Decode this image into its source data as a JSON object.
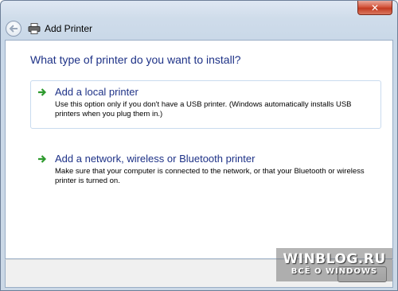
{
  "window": {
    "close_glyph": "✕"
  },
  "header": {
    "title": "Add Printer",
    "back_icon": "back-arrow-icon",
    "app_icon": "printer-icon"
  },
  "question": "What type of printer do you want to install?",
  "options": [
    {
      "title": "Add a local printer",
      "description": "Use this option only if you don't have a USB printer. (Windows automatically installs USB printers when you plug them in.)",
      "icon": "green-arrow-icon"
    },
    {
      "title": "Add a network, wireless or Bluetooth printer",
      "description": "Make sure that your computer is connected to the network, or that your Bluetooth or wireless printer is turned on.",
      "icon": "green-arrow-icon"
    }
  ],
  "watermark": {
    "title": "WINBLOG.RU",
    "subtitle": "ВСЁ О WINDOWS"
  },
  "colors": {
    "link_blue": "#1e3287",
    "arrow_green": "#2e9a2e",
    "close_red": "#c33b22"
  }
}
